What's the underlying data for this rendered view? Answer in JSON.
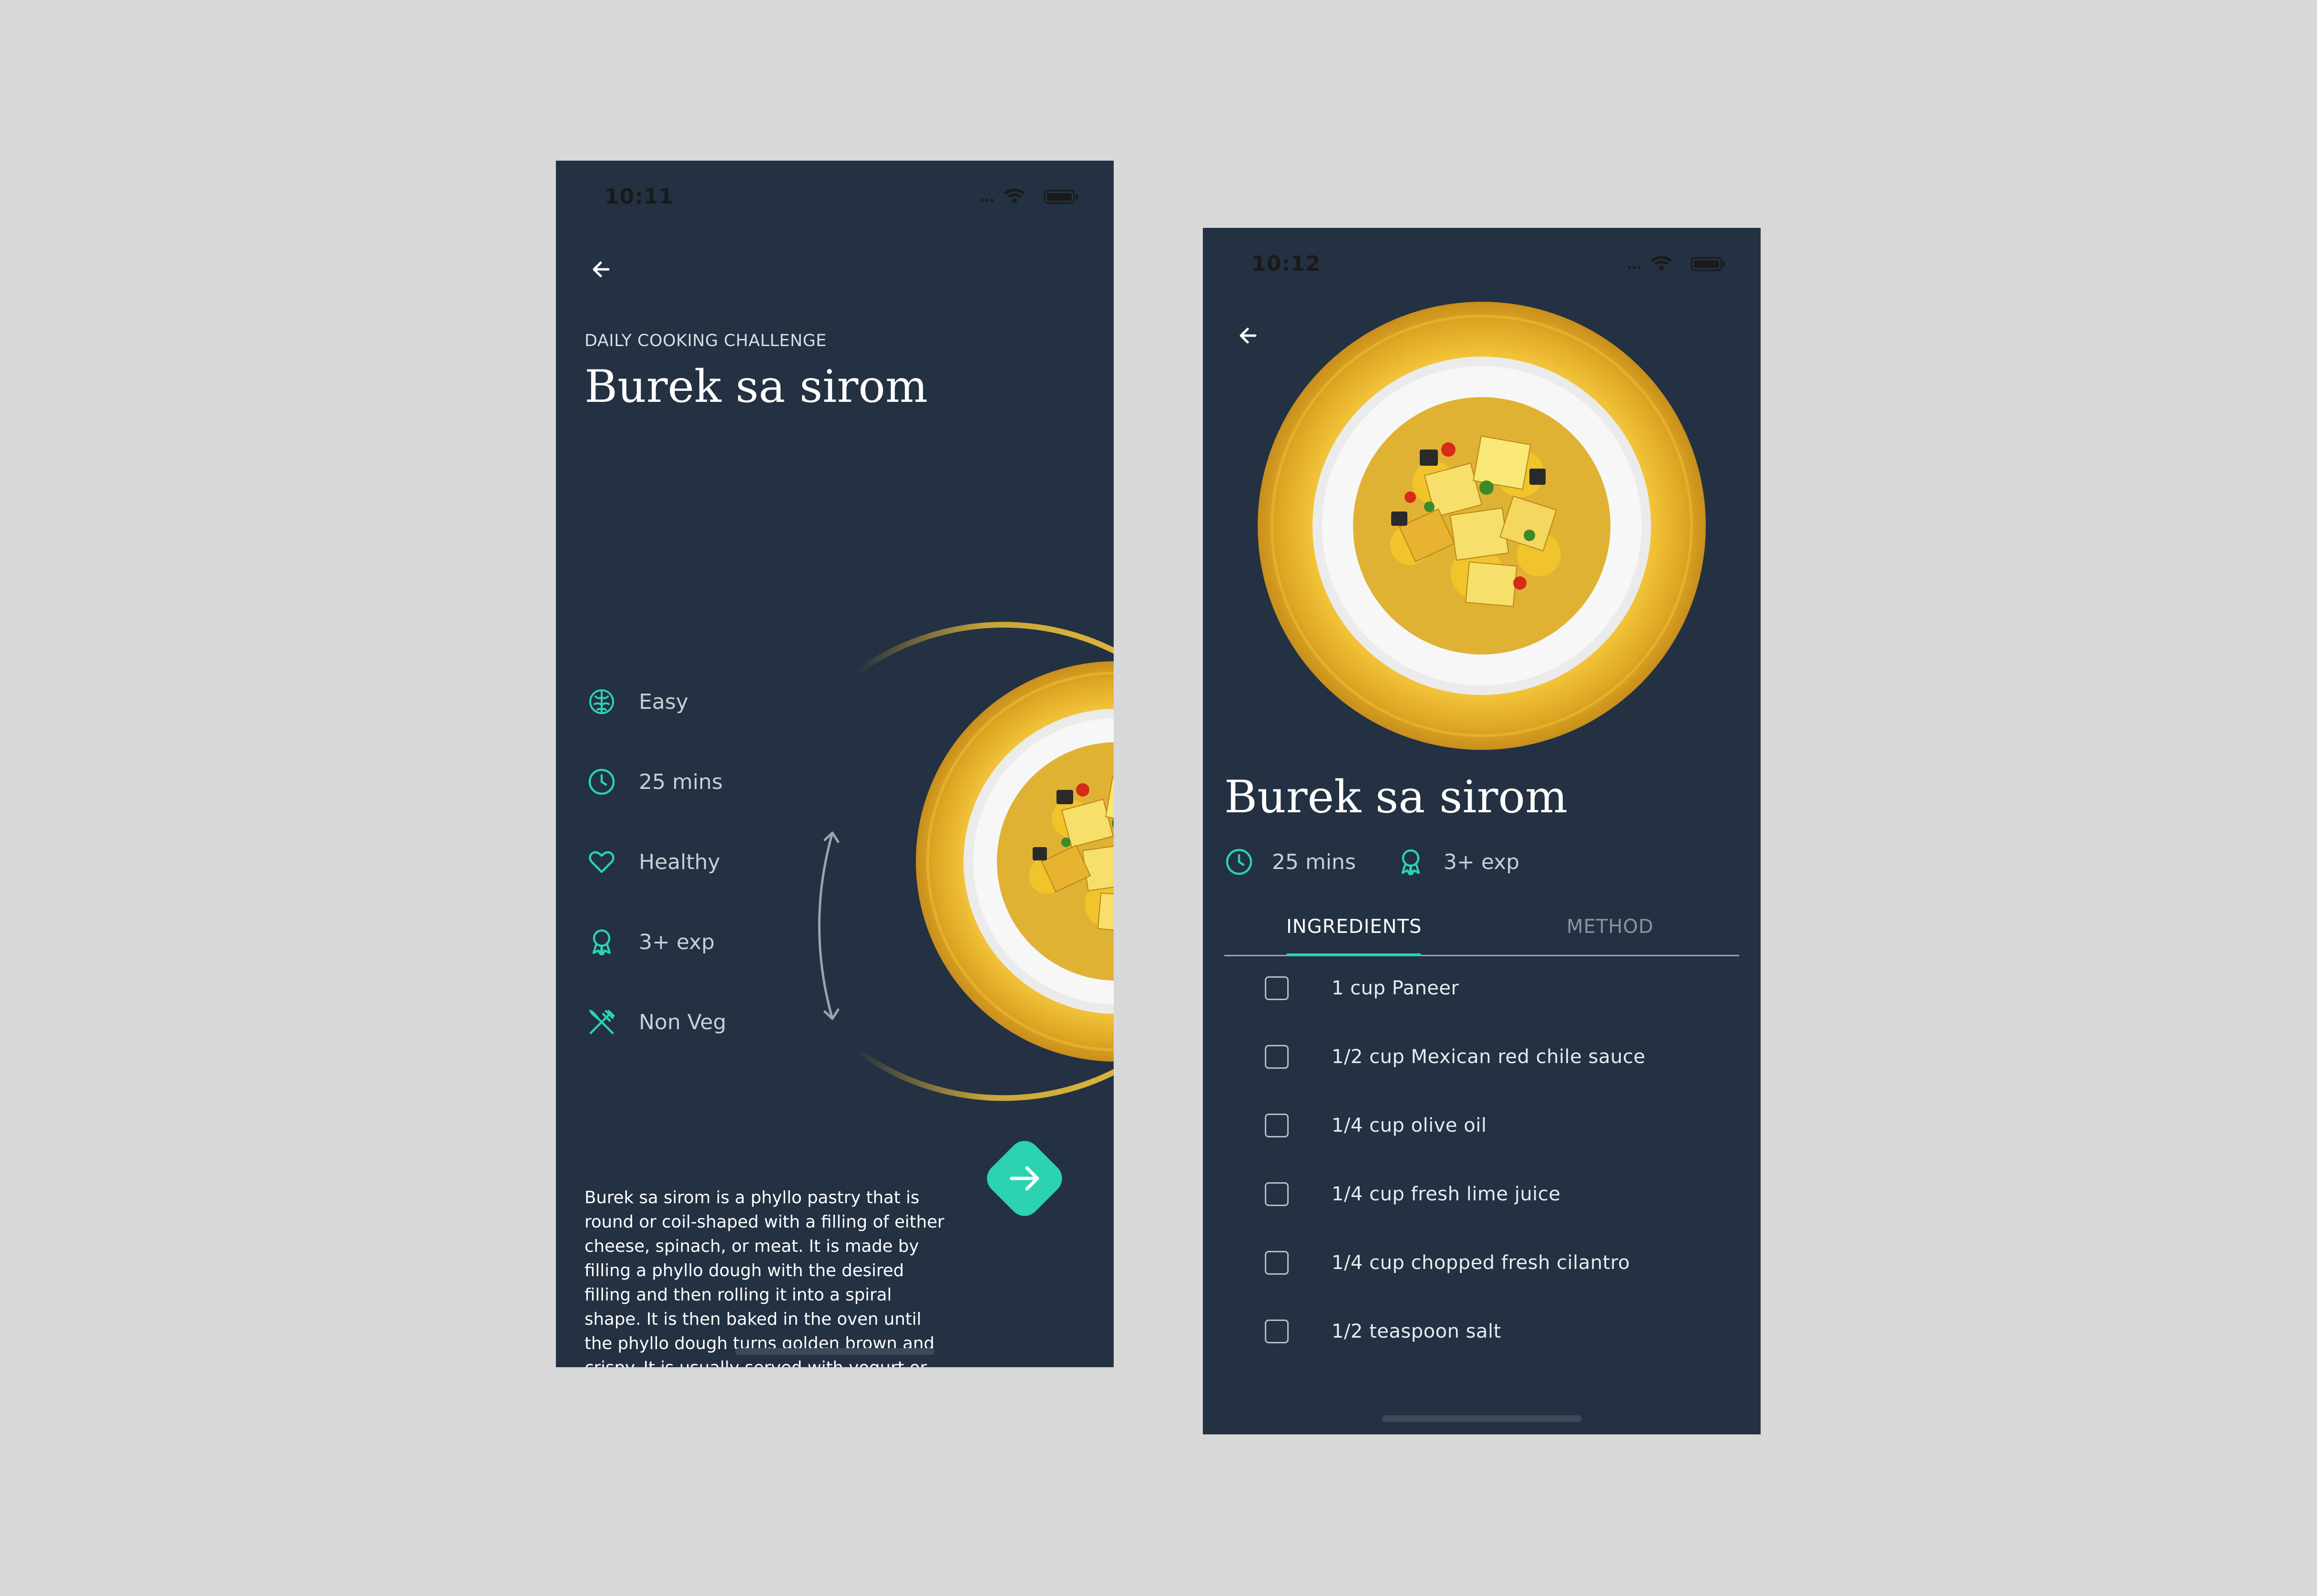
{
  "colors": {
    "background": "#d8d8d8",
    "phone_bg": "#233142",
    "accent": "#2bd3b0",
    "plate": "#f2c230",
    "text_muted": "#c9ced6"
  },
  "screen1": {
    "status_time": "10:11",
    "eyebrow": "DAILY COOKING CHALLENGE",
    "title": "Burek sa sirom",
    "attributes": [
      {
        "icon": "brain-icon",
        "label": "Easy"
      },
      {
        "icon": "clock-icon",
        "label": "25 mins"
      },
      {
        "icon": "heart-icon",
        "label": "Healthy"
      },
      {
        "icon": "award-icon",
        "label": "3+ exp"
      },
      {
        "icon": "utensils-icon",
        "label": "Non Veg"
      }
    ],
    "description": "Burek sa sirom is a phyllo pastry that is round or coil-shaped with a filling of either cheese, spinach, or meat. It is made by filling a phyllo dough with the desired filling and then rolling it into a spiral shape. It is then baked in the oven until the phyllo dough turns golden brown and crispy. It is usually served with yogurt or sour cream."
  },
  "screen2": {
    "status_time": "10:12",
    "title": "Burek sa sirom",
    "meta": [
      {
        "icon": "clock-icon",
        "label": "25 mins"
      },
      {
        "icon": "award-icon",
        "label": "3+ exp"
      }
    ],
    "tabs": [
      {
        "label": "INGREDIENTS",
        "active": true
      },
      {
        "label": "METHOD",
        "active": false
      }
    ],
    "ingredients": [
      "1 cup Paneer",
      "1/2 cup Mexican red chile sauce",
      "1/4 cup olive oil",
      "1/4 cup fresh lime juice",
      "1/4 cup chopped fresh cilantro",
      "1/2 teaspoon salt"
    ]
  }
}
